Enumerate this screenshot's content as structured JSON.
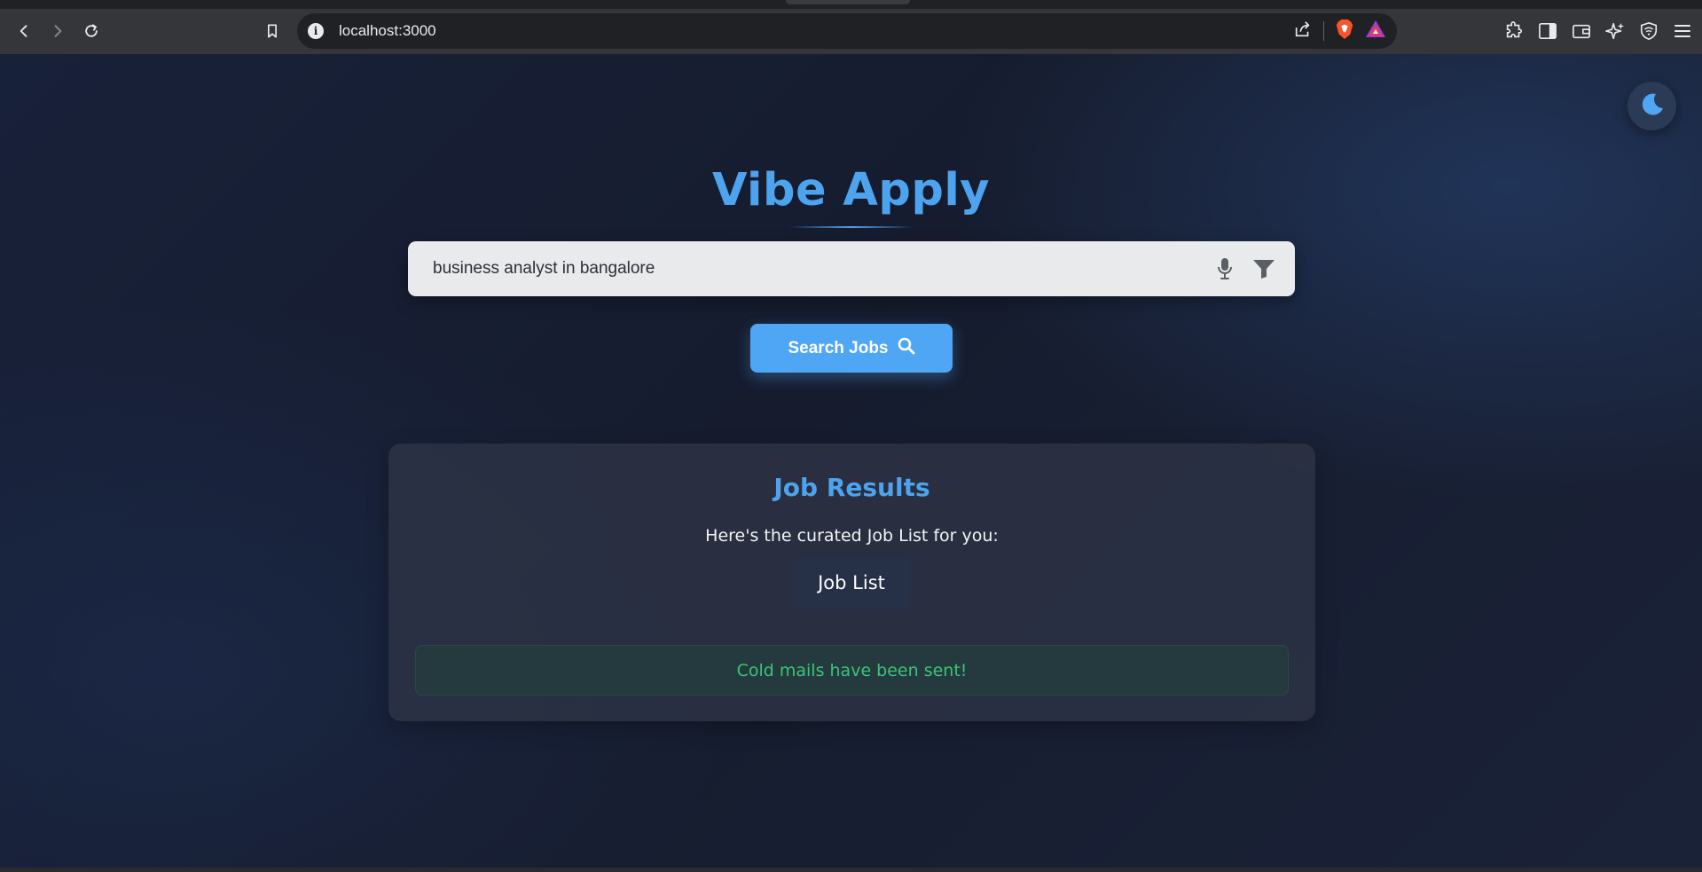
{
  "browser": {
    "url": "localhost:3000",
    "icons": [
      "back-icon",
      "forward-icon",
      "reload-icon",
      "bookmark-icon",
      "info-icon",
      "share-icon",
      "brave-shield-icon",
      "brave-rewards-icon",
      "extensions-icon",
      "sidebar-icon",
      "wallet-icon",
      "leo-ai-icon",
      "vpn-icon",
      "menu-icon"
    ]
  },
  "app": {
    "title": "Vibe Apply",
    "theme_toggle_icon": "moon-icon",
    "accent_color": "#4ea3ee",
    "success_color": "#3cc473"
  },
  "search": {
    "value": "business analyst in bangalore",
    "button_label": "Search Jobs"
  },
  "results": {
    "heading": "Job Results",
    "subtitle": "Here's the curated Job List for you:",
    "job_list_label": "Job List",
    "status_message": "Cold mails have been sent!"
  }
}
